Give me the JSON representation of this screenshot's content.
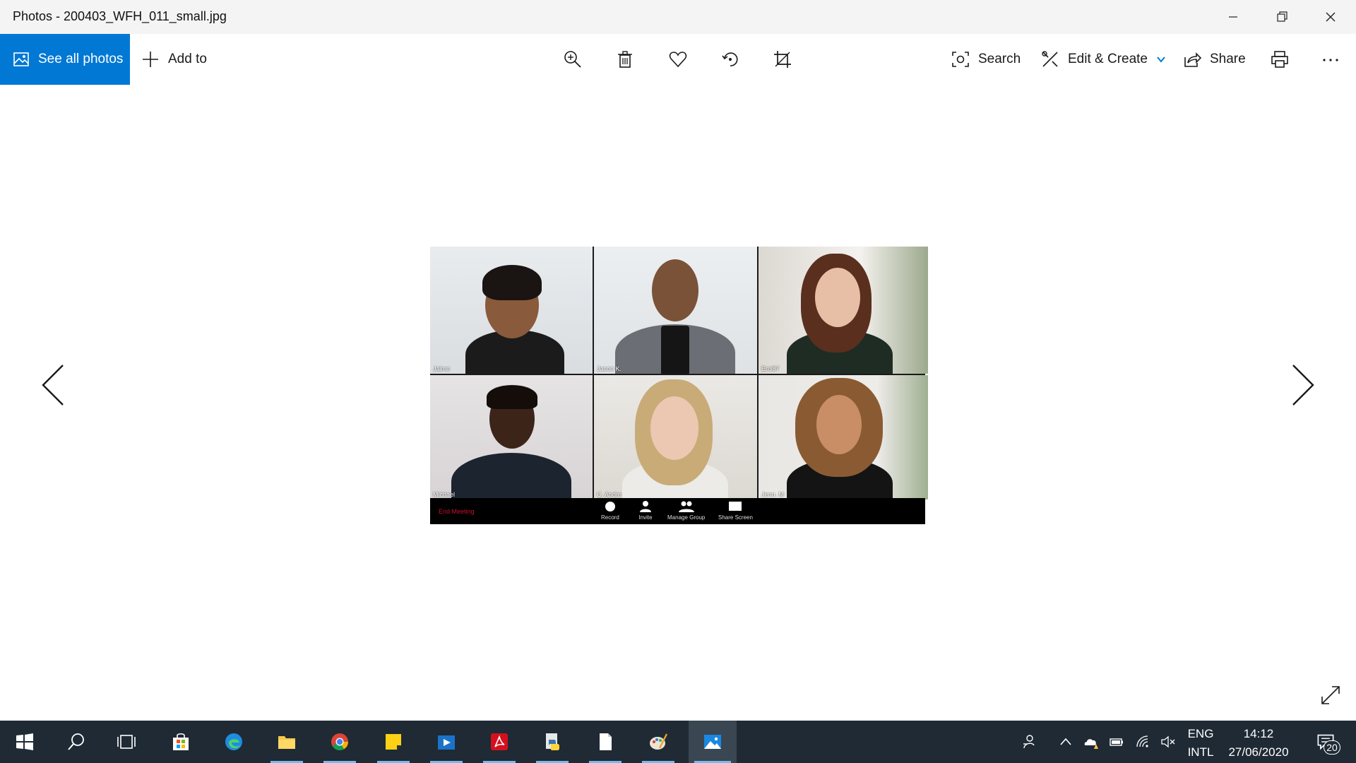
{
  "window": {
    "title": "Photos - 200403_WFH_011_small.jpg"
  },
  "toolbar": {
    "see_all_photos": "See all photos",
    "add_to": "Add to",
    "search": "Search",
    "edit_create": "Edit & Create",
    "share": "Share"
  },
  "photo": {
    "participants": [
      {
        "name": "Jaime"
      },
      {
        "name": "Jason K."
      },
      {
        "name": "Emi87"
      },
      {
        "name": "Michael"
      },
      {
        "name": "C. Andre"
      },
      {
        "name": "Jenn. M"
      }
    ],
    "meeting_bar": {
      "end_label": "End Meeting",
      "controls": [
        {
          "label": "Record",
          "icon": "record-icon"
        },
        {
          "label": "Invite",
          "icon": "invite-icon"
        },
        {
          "label": "Manage Group",
          "icon": "manage-group-icon"
        },
        {
          "label": "Share Screen",
          "icon": "share-screen-icon"
        }
      ]
    }
  },
  "taskbar": {
    "language_line1": "ENG",
    "language_line2": "INTL",
    "time": "14:12",
    "date": "27/06/2020",
    "notification_count": "20",
    "apps": [
      "start-icon",
      "search-icon",
      "task-view-icon",
      "store-icon",
      "edge-icon",
      "file-explorer-icon",
      "chrome-icon",
      "sticky-notes-icon",
      "media-player-icon",
      "acrobat-icon",
      "python-icon",
      "notepad-icon",
      "paint-icon",
      "photos-icon"
    ]
  },
  "colors": {
    "accent": "#0078d4",
    "taskbar": "#1f2a35",
    "end_meeting": "#c8102e"
  }
}
